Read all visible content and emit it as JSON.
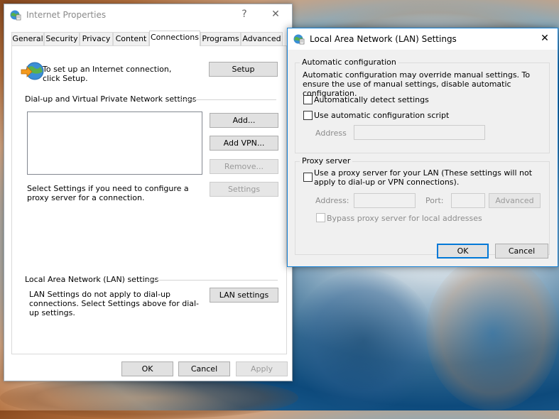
{
  "main_window": {
    "title": "Internet Properties",
    "help_glyph": "?",
    "close_glyph": "✕",
    "tabs": [
      "General",
      "Security",
      "Privacy",
      "Content",
      "Connections",
      "Programs",
      "Advanced"
    ],
    "active_tab": "Connections",
    "setup_text": "To set up an Internet connection, click Setup.",
    "setup_button": "Setup",
    "dialup_section_label": "Dial-up and Virtual Private Network settings",
    "add_button": "Add...",
    "add_vpn_button": "Add VPN...",
    "remove_button": "Remove...",
    "settings_button": "Settings",
    "proxy_hint": "Select Settings if you need to configure a proxy server for a connection.",
    "lan_section_label": "Local Area Network (LAN) settings",
    "lan_note": "LAN Settings do not apply to dial-up connections. Select Settings above for dial-up settings.",
    "lan_settings_button": "LAN settings",
    "ok_button": "OK",
    "cancel_button": "Cancel",
    "apply_button": "Apply"
  },
  "lan_dialog": {
    "title": "Local Area Network (LAN) Settings",
    "close_glyph": "✕",
    "auto_config_group": "Automatic configuration",
    "auto_config_desc": "Automatic configuration may override manual settings.  To ensure the use of manual settings, disable automatic configuration.",
    "auto_detect_label": "Automatically detect settings",
    "auto_script_label": "Use automatic configuration script",
    "address_label": "Address",
    "proxy_group": "Proxy server",
    "use_proxy_label": "Use a proxy server for your LAN (These settings will not apply to dial-up or VPN connections).",
    "proxy_address_label": "Address:",
    "port_label": "Port:",
    "advanced_button": "Advanced",
    "bypass_label": "Bypass proxy server for local addresses",
    "ok_button": "OK",
    "cancel_button": "Cancel",
    "auto_detect_checked": false,
    "auto_script_checked": false,
    "use_proxy_checked": false,
    "bypass_checked": false
  },
  "icons": {
    "window_icon": "internet-globe-icon",
    "setup_icon": "globe-with-arrow-icon"
  },
  "colors": {
    "accent": "#0078d7",
    "button_face": "#e1e1e1",
    "dialog_background": "#f0f0f0"
  }
}
